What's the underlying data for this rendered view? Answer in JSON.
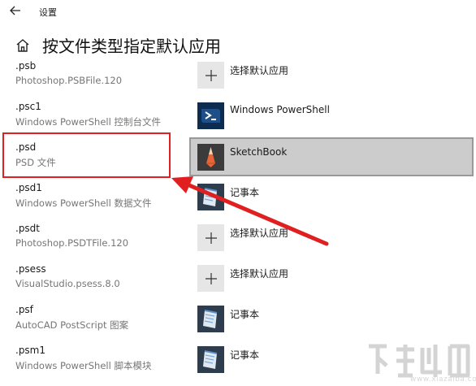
{
  "window": {
    "title": "设置"
  },
  "header": {
    "title": "按文件类型指定默认应用"
  },
  "rows": [
    {
      "ext": ".psb",
      "desc": "Photoshop.PSBFile.120",
      "app": "选择默认应用",
      "icon": "plus-icon"
    },
    {
      "ext": ".psc1",
      "desc": "Windows PowerShell 控制台文件",
      "app": "Windows PowerShell",
      "icon": "powershell-icon"
    },
    {
      "ext": ".psd",
      "desc": "PSD 文件",
      "app": "SketchBook",
      "icon": "sketchbook-icon"
    },
    {
      "ext": ".psd1",
      "desc": "Windows PowerShell 数据文件",
      "app": "记事本",
      "icon": "notepad-icon"
    },
    {
      "ext": ".psdt",
      "desc": "Photoshop.PSDTFile.120",
      "app": "选择默认应用",
      "icon": "plus-icon"
    },
    {
      "ext": ".psess",
      "desc": "VisualStudio.psess.8.0",
      "app": "选择默认应用",
      "icon": "plus-icon"
    },
    {
      "ext": ".psf",
      "desc": "AutoCAD PostScript 图案",
      "app": "记事本",
      "icon": "notepad-icon"
    },
    {
      "ext": ".psm1",
      "desc": "Windows PowerShell 脚本模块",
      "app": "记事本",
      "icon": "notepad-icon"
    }
  ],
  "selected_row": 2,
  "colors": {
    "highlight": "#e02020",
    "selected_bg": "#cccccc",
    "selected_border": "#999999"
  },
  "watermark": {
    "site": "www.xiazaiba.com"
  }
}
